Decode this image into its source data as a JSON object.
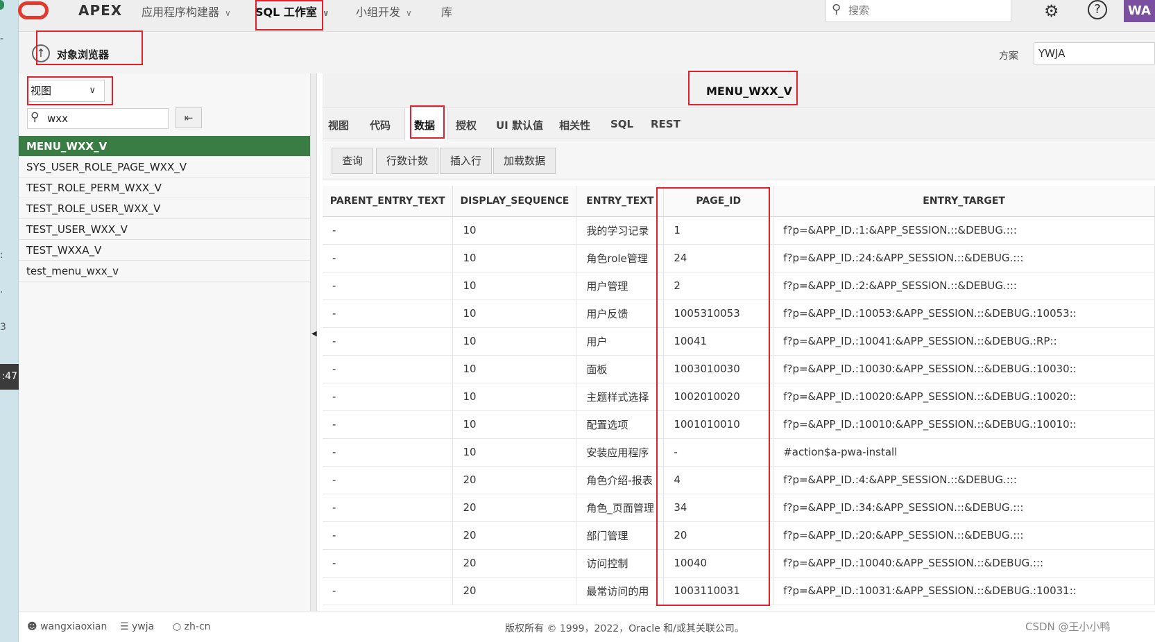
{
  "header": {
    "brand": "APEX",
    "nav": [
      {
        "label": "应用程序构建器",
        "has_menu": true
      },
      {
        "label": "SQL 工作室",
        "has_menu": true,
        "active": true
      },
      {
        "label": "小组开发",
        "has_menu": true
      },
      {
        "label": "库",
        "has_menu": false
      }
    ],
    "search_placeholder": "搜索",
    "avatar_initials": "WA"
  },
  "left_strip": {
    "time_fragment": ":47"
  },
  "page": {
    "title": "对象浏览器",
    "schema_label": "方案",
    "schema_value": "YWJA"
  },
  "sidebar": {
    "object_type": "视图",
    "filter_value": "wxx",
    "objects": [
      "MENU_WXX_V",
      "SYS_USER_ROLE_PAGE_WXX_V",
      "TEST_ROLE_PERM_WXX_V",
      "TEST_ROLE_USER_WXX_V",
      "TEST_USER_WXX_V",
      "TEST_WXXA_V",
      "test_menu_wxx_v"
    ],
    "selected": "MENU_WXX_V"
  },
  "object": {
    "name": "MENU_WXX_V",
    "tabs": [
      "视图",
      "代码",
      "数据",
      "授权",
      "UI 默认值",
      "相关性",
      "SQL",
      "REST"
    ],
    "active_tab": "数据",
    "toolbar": [
      "查询",
      "行数计数",
      "插入行",
      "加载数据"
    ]
  },
  "grid": {
    "columns": [
      "PARENT_ENTRY_TEXT",
      "DISPLAY_SEQUENCE",
      "ENTRY_TEXT",
      "PAGE_ID",
      "ENTRY_TARGET"
    ],
    "rows": [
      [
        "-",
        "10",
        "我的学习记录",
        "1",
        "f?p=&APP_ID.:1:&APP_SESSION.::&DEBUG.:::"
      ],
      [
        "-",
        "10",
        "角色role管理",
        "24",
        "f?p=&APP_ID.:24:&APP_SESSION.::&DEBUG.:::"
      ],
      [
        "-",
        "10",
        "用户管理",
        "2",
        "f?p=&APP_ID.:2:&APP_SESSION.::&DEBUG.:::"
      ],
      [
        "-",
        "10",
        "用户反馈",
        "1005310053",
        "f?p=&APP_ID.:10053:&APP_SESSION.::&DEBUG.:10053::"
      ],
      [
        "-",
        "10",
        "用户",
        "10041",
        "f?p=&APP_ID.:10041:&APP_SESSION.::&DEBUG.:RP::"
      ],
      [
        "-",
        "10",
        "面板",
        "1003010030",
        "f?p=&APP_ID.:10030:&APP_SESSION.::&DEBUG.:10030::"
      ],
      [
        "-",
        "10",
        "主题样式选择",
        "1002010020",
        "f?p=&APP_ID.:10020:&APP_SESSION.::&DEBUG.:10020::"
      ],
      [
        "-",
        "10",
        "配置选项",
        "1001010010",
        "f?p=&APP_ID.:10010:&APP_SESSION.::&DEBUG.:10010::"
      ],
      [
        "-",
        "10",
        "安装应用程序",
        "-",
        "#action$a-pwa-install"
      ],
      [
        "-",
        "20",
        "角色介绍-报表",
        "4",
        "f?p=&APP_ID.:4:&APP_SESSION.::&DEBUG.:::"
      ],
      [
        "-",
        "20",
        "角色_页面管理",
        "34",
        "f?p=&APP_ID.:34:&APP_SESSION.::&DEBUG.:::"
      ],
      [
        "-",
        "20",
        "部门管理",
        "20",
        "f?p=&APP_ID.:20:&APP_SESSION.::&DEBUG.:::"
      ],
      [
        "-",
        "20",
        "访问控制",
        "10040",
        "f?p=&APP_ID.:10040:&APP_SESSION.::&DEBUG.:::"
      ],
      [
        "-",
        "20",
        "最常访问的用",
        "1003110031",
        "f?p=&APP_ID.:10031:&APP_SESSION.::&DEBUG.:10031::"
      ]
    ]
  },
  "footer": {
    "user": "wangxiaoxian",
    "workspace": "ywja",
    "language": "zh-cn",
    "copyright": "版权所有 © 1999，2022，Oracle 和/或其关联公司。",
    "watermark": "CSDN @王小小鸭"
  },
  "colors": {
    "selected_item": "#3a7d44",
    "annotation_box": "#e0202a",
    "logo": "#e03a2f",
    "avatar": "#7a4f9f"
  }
}
